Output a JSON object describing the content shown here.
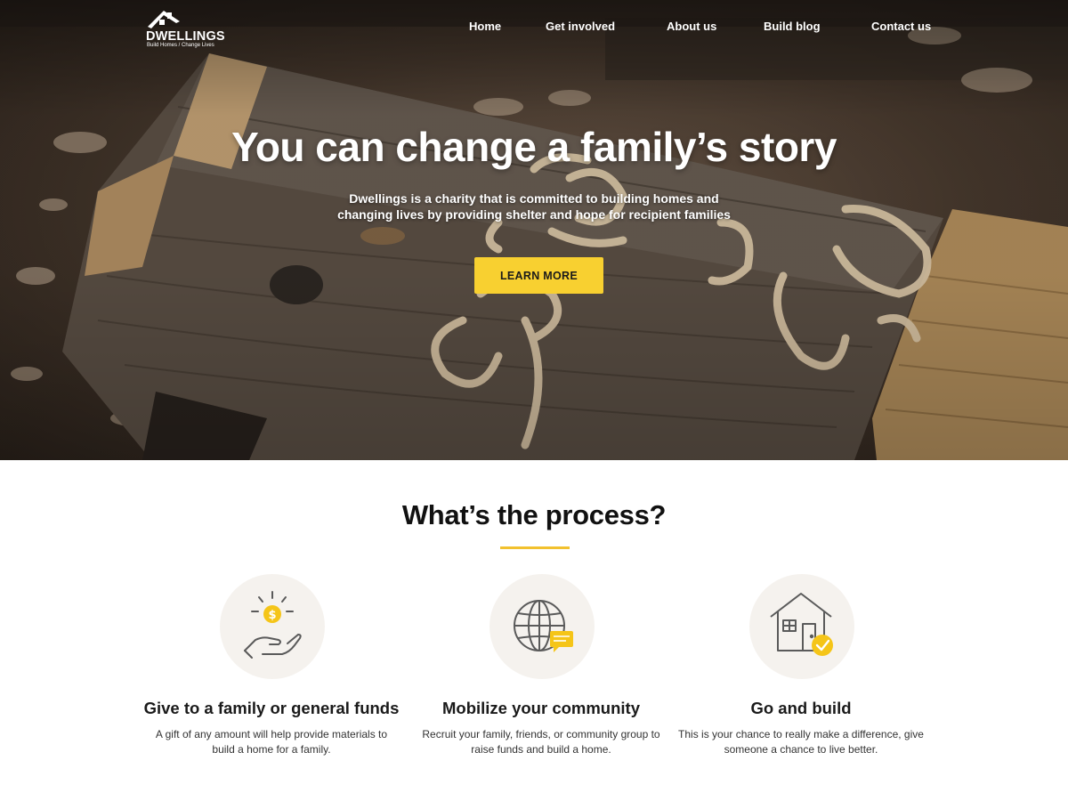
{
  "brand": {
    "name": "DWELLINGS",
    "tagline": "Build Homes / Change Lives",
    "logo_icon": "house-roof-icon"
  },
  "nav": {
    "items": [
      {
        "label": "Home"
      },
      {
        "label": "Get involved"
      },
      {
        "label": "About us"
      },
      {
        "label": "Build blog"
      },
      {
        "label": "Contact us"
      }
    ]
  },
  "hero": {
    "title": "You can change a family’s story",
    "subtitle": "Dwellings is a charity that is committed to building homes and changing lives by providing shelter and hope for recipient families",
    "cta_label": "LEARN MORE",
    "background": "wooden-sawhorse-with-shavings-photo"
  },
  "process": {
    "title": "What’s the process?",
    "steps": [
      {
        "icon": "hand-with-coin-icon",
        "title": "Give to a family or general funds",
        "desc": "A gift of any amount will help provide materials to build a home for a family."
      },
      {
        "icon": "globe-with-chat-icon",
        "title": "Mobilize your community",
        "desc": "Recruit your family, friends, or community group to raise funds and build a home."
      },
      {
        "icon": "house-with-check-icon",
        "title": "Go and build",
        "desc": "This is your chance to really make a difference, give someone a chance to live better."
      }
    ]
  },
  "colors": {
    "accent": "#f8d030",
    "underline": "#f2c12e",
    "icon_circle": "#f5f2ee",
    "icon_stroke": "#5a5a5a",
    "text_dark": "#111111"
  }
}
